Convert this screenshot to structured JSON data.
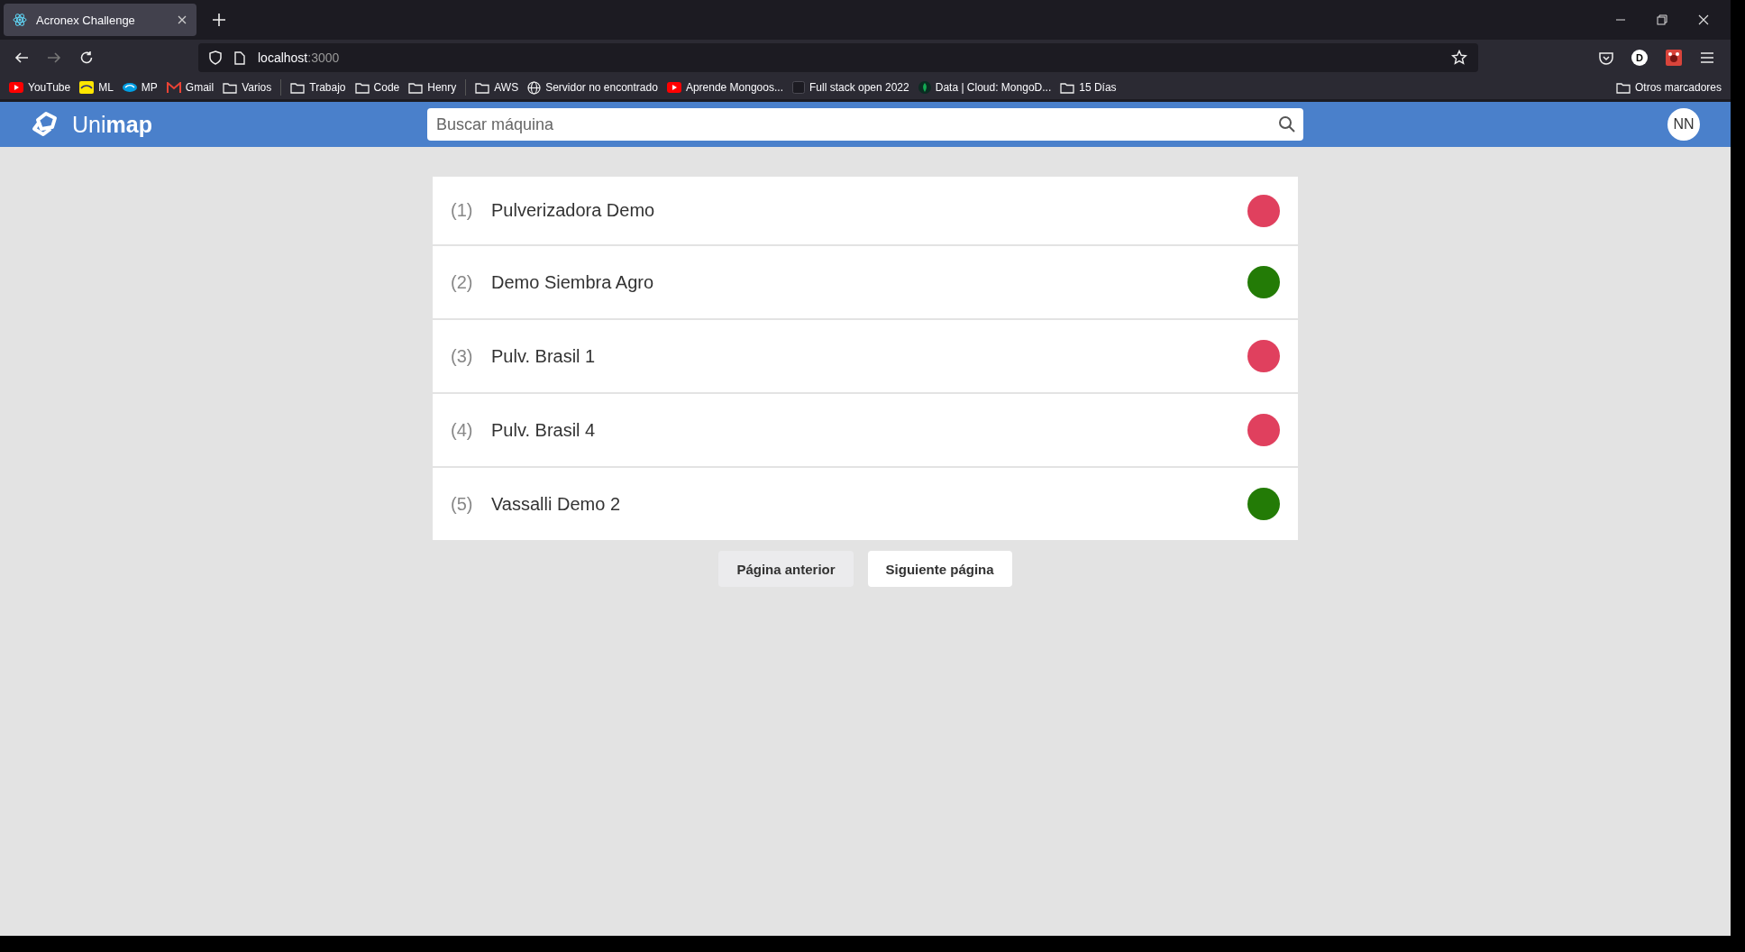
{
  "browser": {
    "tabs": [
      {
        "title": "Acronex Challenge",
        "selected": true
      }
    ],
    "url": {
      "host": "localhost",
      "port": ":3000"
    },
    "bookmark_groups": [
      {
        "items": [
          {
            "label": "YouTube",
            "kind": "youtube"
          },
          {
            "label": "ML",
            "kind": "ml"
          },
          {
            "label": "MP",
            "kind": "mp"
          },
          {
            "label": "Gmail",
            "kind": "gmail"
          },
          {
            "label": "Varios",
            "kind": "folder"
          }
        ]
      },
      {
        "items": [
          {
            "label": "Trabajo",
            "kind": "folder"
          },
          {
            "label": "Code",
            "kind": "folder"
          },
          {
            "label": "Henry",
            "kind": "folder"
          }
        ]
      },
      {
        "items": [
          {
            "label": "AWS",
            "kind": "folder"
          },
          {
            "label": "Servidor no encontrado",
            "kind": "globe"
          },
          {
            "label": "Aprende Mongoos...",
            "kind": "youtube"
          },
          {
            "label": "Full stack open 2022",
            "kind": "blank"
          },
          {
            "label": "Data | Cloud: MongoD...",
            "kind": "leaf"
          },
          {
            "label": "15 Días",
            "kind": "folder"
          }
        ]
      }
    ],
    "other_bookmarks": "Otros marcadores",
    "profile_initial": "D"
  },
  "app": {
    "brand_light": "Uni",
    "brand_bold": "map",
    "search": {
      "placeholder": "Buscar máquina"
    },
    "avatar": "NN"
  },
  "machines": [
    {
      "index": "(1)",
      "name": "Pulverizadora Demo",
      "color": "#e0405e"
    },
    {
      "index": "(2)",
      "name": "Demo Siembra Agro",
      "color": "#237b06"
    },
    {
      "index": "(3)",
      "name": "Pulv. Brasil 1",
      "color": "#e0405e"
    },
    {
      "index": "(4)",
      "name": "Pulv. Brasil 4",
      "color": "#e0405e"
    },
    {
      "index": "(5)",
      "name": "Vassalli Demo 2",
      "color": "#237b06"
    }
  ],
  "pagination": [
    {
      "label": "Página anterior",
      "disabled": true
    },
    {
      "label": "Siguiente página",
      "disabled": false
    }
  ]
}
